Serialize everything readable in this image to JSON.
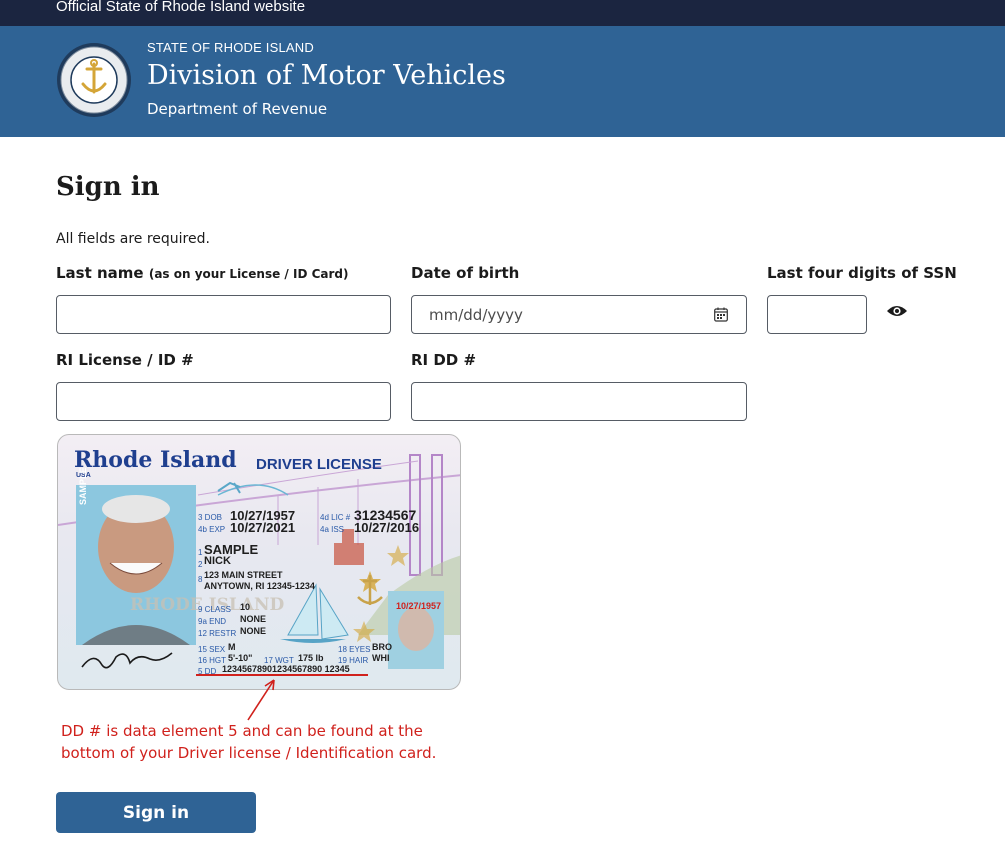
{
  "banner": {
    "text": "Official State of Rhode Island website"
  },
  "header": {
    "state": "STATE OF RHODE ISLAND",
    "title": "Division of Motor Vehicles",
    "department": "Department of Revenue",
    "seal_text": "SEAL OF RHODE ISLAND"
  },
  "form": {
    "title": "Sign in",
    "required_note": "All fields are required.",
    "last_name": {
      "label": "Last name",
      "hint": "(as on your License / ID Card)",
      "value": ""
    },
    "dob": {
      "label": "Date of birth",
      "placeholder": "mm/dd/yyyy"
    },
    "ssn": {
      "label": "Last four digits of SSN",
      "value": ""
    },
    "license": {
      "label": "RI License / ID #",
      "value": ""
    },
    "dd": {
      "label": "RI DD #",
      "value": ""
    },
    "submit_label": "Sign in"
  },
  "sample_card": {
    "state": "Rhode Island",
    "country": "USA",
    "type": "DRIVER LICENSE",
    "side_text": "SAMPLE",
    "dob_code": "3 DOB",
    "dob": "10/27/1957",
    "exp_code": "4b EXP",
    "exp": "10/27/2021",
    "lic_code": "4d LIC #",
    "lic": "31234567",
    "iss_code": "4a ISS",
    "iss": "10/27/2016",
    "last_name_code": "1",
    "last_name": "SAMPLE",
    "first_name_code": "2",
    "first_name": "NICK",
    "address_code": "8",
    "address_1": "123 MAIN STREET",
    "address_2": "ANYTOWN, RI 12345-1234",
    "watermark": "RHODE ISLAND",
    "class_code": "9 CLASS",
    "class": "10",
    "end_code": "9a END",
    "end": "NONE",
    "restr_code": "12 RESTR",
    "restr": "NONE",
    "sex_code": "15 SEX",
    "sex": "M",
    "hgt_code": "16 HGT",
    "hgt": "5'-10\"",
    "wgt_code": "17 WGT",
    "wgt": "175 lb",
    "eyes_code": "18 EYES",
    "eyes": "BRO",
    "hair_code": "19 HAIR",
    "hair": "WHI",
    "dd_code": "5 DD",
    "dd": "12345678901234567890 12345",
    "ghost_date": "10/27/1957",
    "signature": "Nick Sample"
  },
  "dd_note": "DD # is data element 5 and can be found at the bottom of your Driver license / Identification card.",
  "colors": {
    "header": "#2f6395",
    "banner": "#1b2540",
    "note": "#d0211c",
    "button": "#2f6395"
  }
}
